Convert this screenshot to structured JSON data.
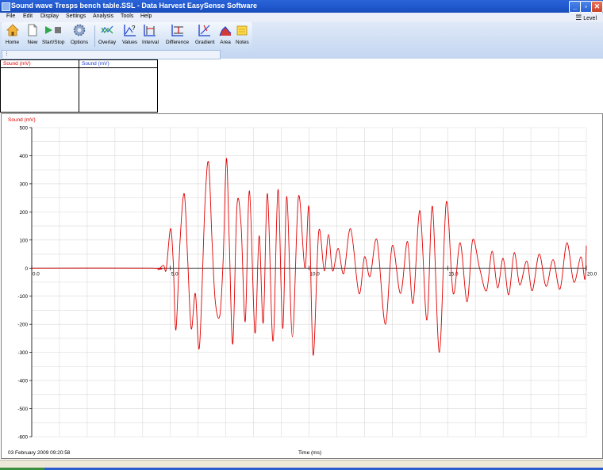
{
  "window": {
    "title": "Sound wave Tresps bench table.SSL - Data Harvest EasySense Software"
  },
  "menu": [
    "File",
    "Edit",
    "Display",
    "Settings",
    "Analysis",
    "Tools",
    "Help"
  ],
  "level_label": "Level",
  "toolbar": {
    "home": "Home",
    "new": "New",
    "start_stop": "Start/Stop",
    "options": "Options",
    "overlay": "Overlay",
    "values": "Values",
    "interval": "Interval",
    "difference": "Difference",
    "gradient": "Gradient",
    "area": "Area",
    "notes": "Notes"
  },
  "value_table": {
    "col1": "Sound (mV)",
    "col2": "Sound (mV)"
  },
  "graph": {
    "date": "03 February 2009  09:20:58"
  },
  "colors": {
    "trace": "#e00000",
    "col2_header": "#1a3dcc",
    "title_bar": "#1f56cc"
  },
  "chart_data": {
    "type": "line",
    "ylabel": "Sound (mV)",
    "xlabel": "Time (ms)",
    "xlim": [
      0,
      20
    ],
    "ylim": [
      -600,
      500
    ],
    "x_ticks": [
      "0.0",
      "5.0",
      "10.0",
      "15.0",
      "20.0"
    ],
    "y_ticks": [
      "500",
      "400",
      "300",
      "200",
      "100",
      "0",
      "-100",
      "-200",
      "-300",
      "-400",
      "-500",
      "-600"
    ],
    "grid": true,
    "series": [
      {
        "name": "Sound (mV)",
        "points": [
          [
            0.0,
            0
          ],
          [
            4.3,
            0
          ],
          [
            4.55,
            -5
          ],
          [
            4.75,
            10
          ],
          [
            4.85,
            -5
          ],
          [
            5.0,
            140
          ],
          [
            5.1,
            30
          ],
          [
            5.2,
            -220
          ],
          [
            5.35,
            100
          ],
          [
            5.5,
            265
          ],
          [
            5.62,
            40
          ],
          [
            5.75,
            -215
          ],
          [
            5.9,
            -90
          ],
          [
            6.05,
            -280
          ],
          [
            6.25,
            235
          ],
          [
            6.38,
            375
          ],
          [
            6.5,
            100
          ],
          [
            6.62,
            -120
          ],
          [
            6.78,
            -170
          ],
          [
            6.9,
            25
          ],
          [
            7.02,
            390
          ],
          [
            7.12,
            110
          ],
          [
            7.25,
            -270
          ],
          [
            7.4,
            220
          ],
          [
            7.55,
            150
          ],
          [
            7.7,
            -190
          ],
          [
            7.85,
            275
          ],
          [
            8.05,
            -230
          ],
          [
            8.2,
            115
          ],
          [
            8.35,
            -195
          ],
          [
            8.5,
            265
          ],
          [
            8.7,
            -260
          ],
          [
            8.88,
            280
          ],
          [
            9.05,
            -215
          ],
          [
            9.2,
            255
          ],
          [
            9.4,
            -245
          ],
          [
            9.62,
            255
          ],
          [
            9.85,
            0
          ],
          [
            10.0,
            215
          ],
          [
            10.15,
            -310
          ],
          [
            10.35,
            130
          ],
          [
            10.55,
            -10
          ],
          [
            10.7,
            120
          ],
          [
            10.85,
            -10
          ],
          [
            11.05,
            70
          ],
          [
            11.25,
            -20
          ],
          [
            11.5,
            140
          ],
          [
            11.8,
            -90
          ],
          [
            12.0,
            40
          ],
          [
            12.2,
            -30
          ],
          [
            12.45,
            100
          ],
          [
            12.75,
            -200
          ],
          [
            13.0,
            80
          ],
          [
            13.3,
            -90
          ],
          [
            13.55,
            95
          ],
          [
            13.75,
            -125
          ],
          [
            14.0,
            205
          ],
          [
            14.25,
            -185
          ],
          [
            14.45,
            220
          ],
          [
            14.7,
            -300
          ],
          [
            14.95,
            235
          ],
          [
            15.2,
            -90
          ],
          [
            15.45,
            90
          ],
          [
            15.7,
            -120
          ],
          [
            15.9,
            100
          ],
          [
            16.15,
            0
          ],
          [
            16.4,
            -80
          ],
          [
            16.6,
            60
          ],
          [
            16.8,
            -70
          ],
          [
            17.0,
            35
          ],
          [
            17.2,
            -95
          ],
          [
            17.4,
            55
          ],
          [
            17.6,
            -60
          ],
          [
            17.85,
            25
          ],
          [
            18.05,
            -80
          ],
          [
            18.3,
            50
          ],
          [
            18.55,
            -65
          ],
          [
            18.8,
            30
          ],
          [
            19.05,
            -75
          ],
          [
            19.3,
            90
          ],
          [
            19.55,
            -50
          ],
          [
            19.8,
            40
          ],
          [
            19.95,
            -40
          ],
          [
            20.0,
            80
          ]
        ]
      }
    ]
  }
}
